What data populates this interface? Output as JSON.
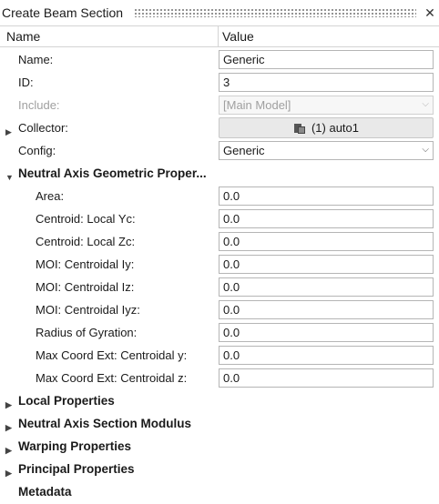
{
  "window": {
    "title": "Create Beam Section"
  },
  "header": {
    "name_col": "Name",
    "value_col": "Value"
  },
  "props": {
    "name": {
      "label": "Name:",
      "value": "Generic"
    },
    "id": {
      "label": "ID:",
      "value": "3"
    },
    "include": {
      "label": "Include:",
      "value": "[Main Model]"
    },
    "collector": {
      "label": "Collector:",
      "value": "(1) auto1"
    },
    "config": {
      "label": "Config:",
      "value": "Generic"
    }
  },
  "neutral_axis": {
    "title": "Neutral Axis Geometric Proper...",
    "rows": [
      {
        "label": "Area:",
        "value": "0.0"
      },
      {
        "label": "Centroid: Local Yc:",
        "value": "0.0"
      },
      {
        "label": "Centroid: Local Zc:",
        "value": "0.0"
      },
      {
        "label": "MOI: Centroidal Iy:",
        "value": "0.0"
      },
      {
        "label": "MOI: Centroidal Iz:",
        "value": "0.0"
      },
      {
        "label": "MOI: Centroidal Iyz:",
        "value": "0.0"
      },
      {
        "label": "Radius of Gyration:",
        "value": "0.0"
      },
      {
        "label": "Max Coord Ext: Centroidal y:",
        "value": "0.0"
      },
      {
        "label": "Max Coord Ext: Centroidal z:",
        "value": "0.0"
      }
    ]
  },
  "sections": [
    "Local Properties",
    "Neutral Axis Section Modulus",
    "Warping Properties",
    "Principal Properties",
    "Metadata"
  ],
  "icons": {
    "expanded": "triangle-down",
    "collapsed": "triangle-right",
    "close": "close-x",
    "collector": "component-collector"
  }
}
